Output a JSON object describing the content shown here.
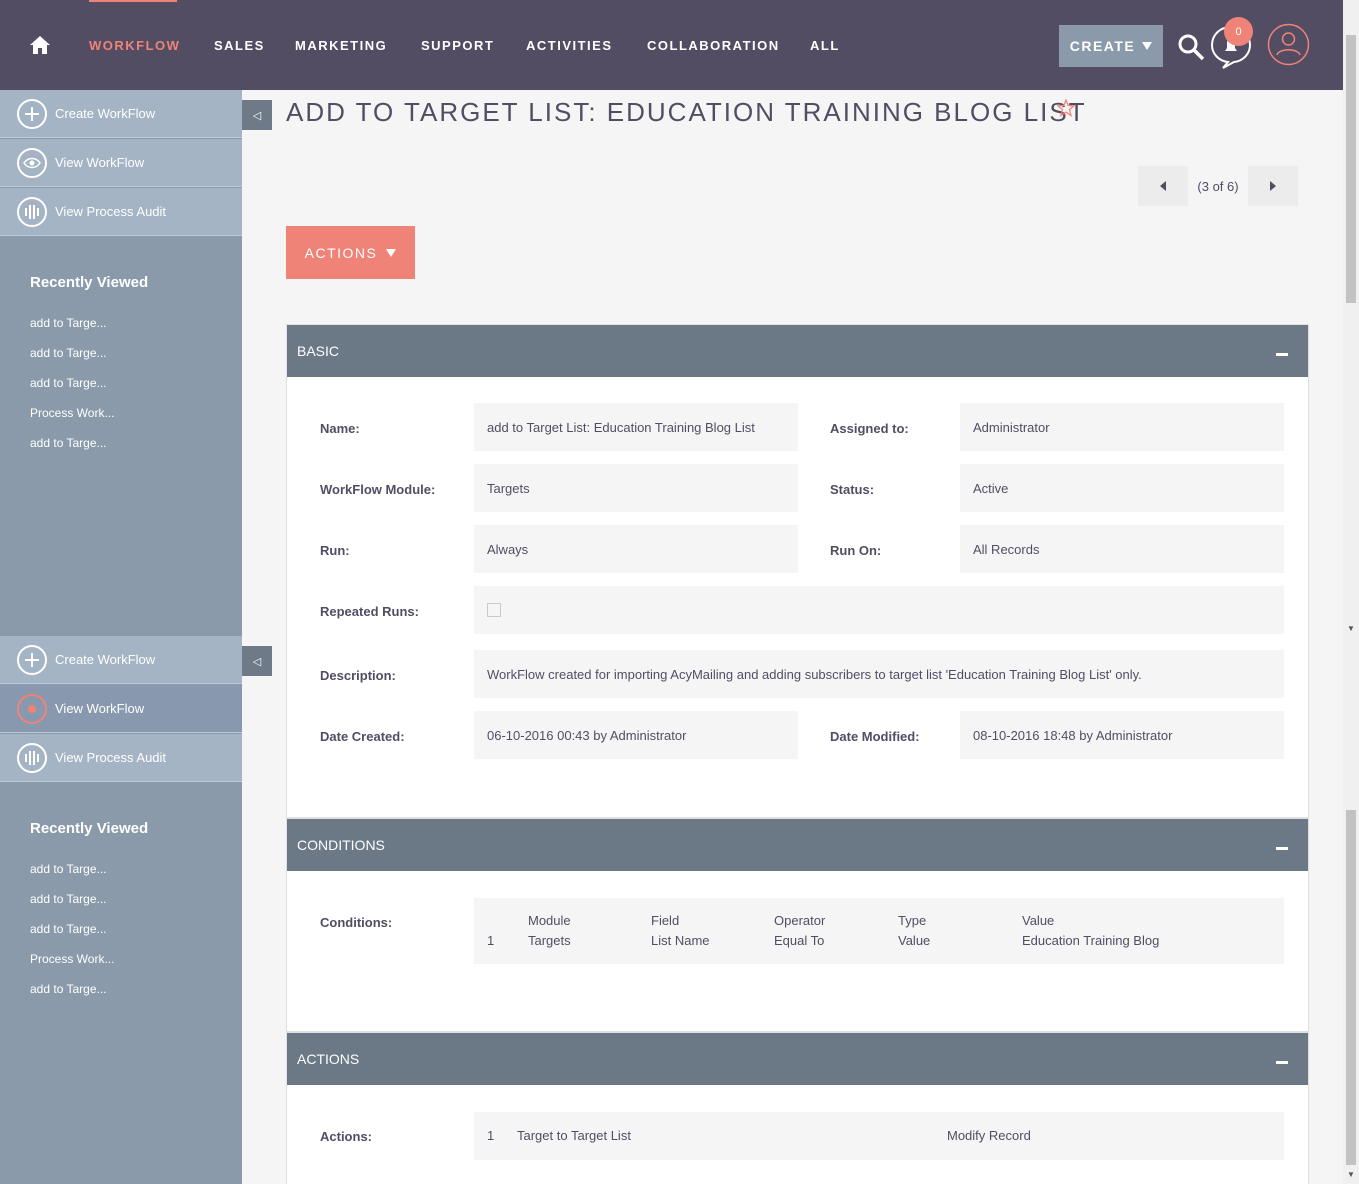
{
  "nav": {
    "items": [
      "WORKFLOW",
      "SALES",
      "MARKETING",
      "SUPPORT",
      "ACTIVITIES",
      "COLLABORATION",
      "ALL"
    ],
    "create_label": "CREATE",
    "notification_count": "0",
    "accent_color": "#f08377",
    "bar_color": "#534d64"
  },
  "sidebar": {
    "actions": [
      "Create WorkFlow",
      "View WorkFlow",
      "View Process Audit"
    ],
    "recent_title": "Recently Viewed",
    "recent_items": [
      "add to Targe...",
      "add to Targe...",
      "add to Targe...",
      "Process Work...",
      "add to Targe..."
    ]
  },
  "page": {
    "title": "ADD TO TARGET LIST: EDUCATION TRAINING BLOG LIST",
    "pager": "(3 of 6)",
    "actions_label": "ACTIONS"
  },
  "basic": {
    "header": "BASIC",
    "name_label": "Name:",
    "name_value": "add to Target List: Education Training Blog List",
    "assigned_label": "Assigned to:",
    "assigned_value": "Administrator",
    "module_label": "WorkFlow Module:",
    "module_value": "Targets",
    "status_label": "Status:",
    "status_value": "Active",
    "run_label": "Run:",
    "run_value": "Always",
    "runon_label": "Run On:",
    "runon_value": "All Records",
    "repeated_label": "Repeated Runs:",
    "description_label": "Description:",
    "description_value": "WorkFlow created for importing AcyMailing and adding subscribers to target list 'Education Training Blog List' only.",
    "created_label": "Date Created:",
    "created_value": "06-10-2016 00:43 by Administrator",
    "modified_label": "Date Modified:",
    "modified_value": "08-10-2016 18:48 by Administrator"
  },
  "conditions": {
    "header": "CONDITIONS",
    "label": "Conditions:",
    "columns": [
      "Module",
      "Field",
      "Operator",
      "Type",
      "Value"
    ],
    "row": {
      "num": "1",
      "module": "Targets",
      "field": "List Name",
      "operator": "Equal To",
      "type": "Value",
      "value": "Education Training Blog"
    }
  },
  "actions_panel": {
    "header": "ACTIONS",
    "label": "Actions:",
    "row": {
      "num": "1",
      "name": "Target to Target List",
      "action": "Modify Record"
    }
  }
}
